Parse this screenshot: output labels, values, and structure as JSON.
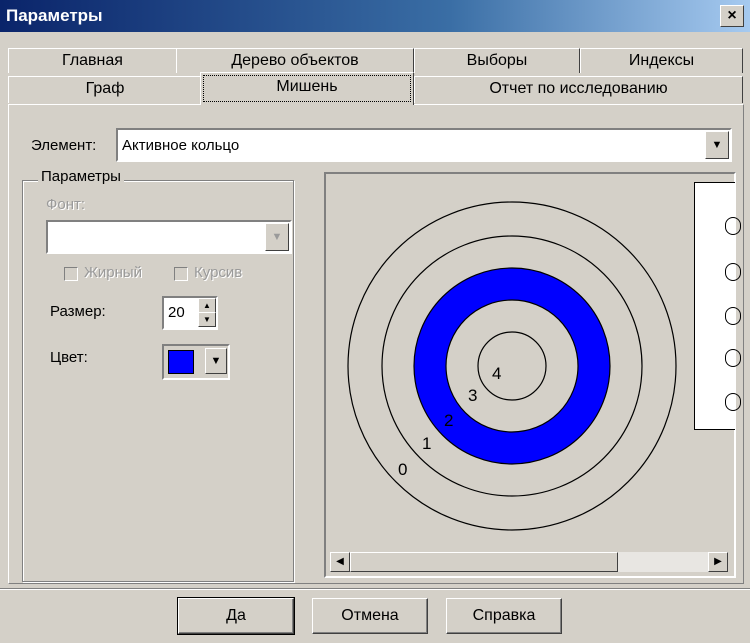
{
  "window": {
    "title": "Параметры",
    "close_glyph": "×"
  },
  "tabs": {
    "row1": [
      "Главная",
      "Дерево объектов",
      "Выборы",
      "Индексы"
    ],
    "row2": [
      "Граф",
      "Мишень",
      "Отчет по исследованию"
    ],
    "active": "Мишень"
  },
  "element": {
    "label": "Элемент:",
    "value": "Активное кольцо"
  },
  "params": {
    "group_title": "Параметры",
    "font_label": "Фонт:",
    "font_value": "",
    "bold_label": "Жирный",
    "italic_label": "Курсив",
    "size_label": "Размер:",
    "size_value": "20",
    "color_label": "Цвет:",
    "color_value": "#0000ff"
  },
  "target": {
    "ring_labels": [
      "0",
      "1",
      "2",
      "3",
      "4"
    ],
    "active_ring_color": "#0000ff"
  },
  "buttons": {
    "ok": "Да",
    "cancel": "Отмена",
    "help": "Справка"
  },
  "icons": [
    "close-icon",
    "dropdown-arrow-icon",
    "spin-up-icon",
    "spin-down-icon",
    "scroll-left-icon",
    "scroll-right-icon"
  ]
}
